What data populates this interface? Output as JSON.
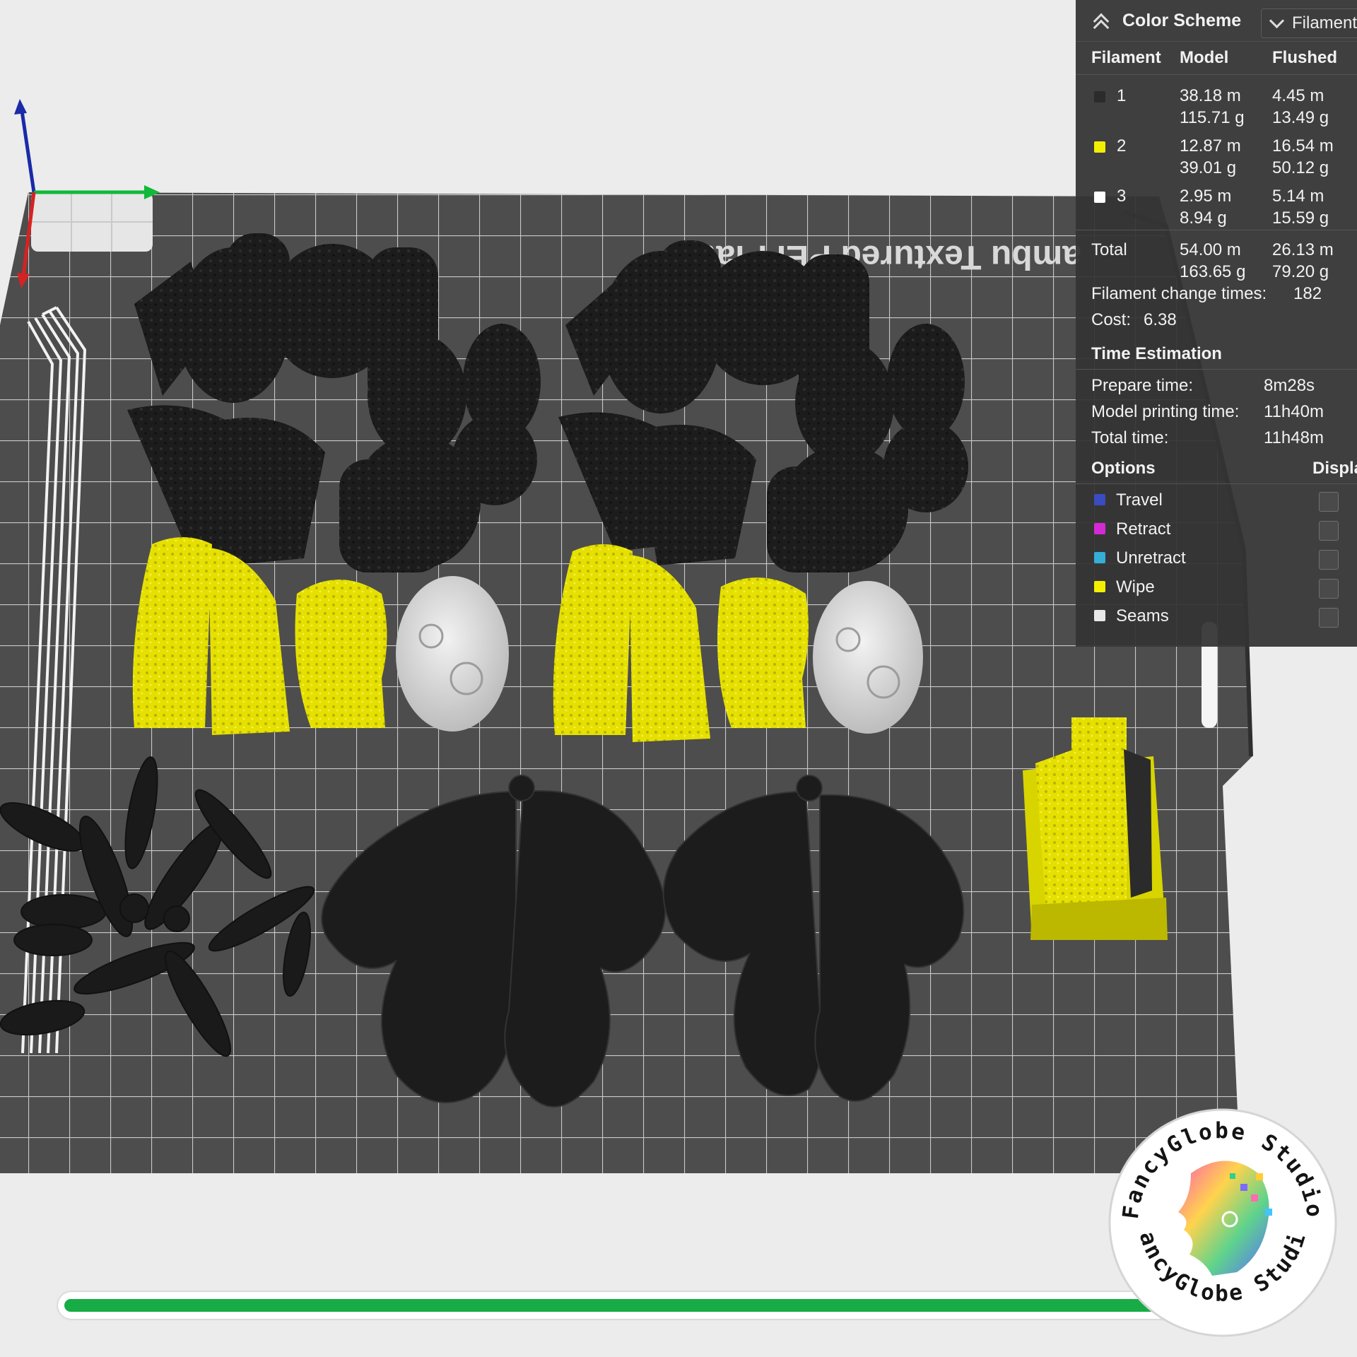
{
  "bed": {
    "label": "ambu Textured PEI Plate"
  },
  "panel": {
    "title": "Color Scheme",
    "scheme_select": "Filament",
    "columns": {
      "filament": "Filament",
      "model": "Model",
      "flushed": "Flushed"
    },
    "filaments": [
      {
        "id": "1",
        "color": "#2b2b2b",
        "model_len": "38.18 m",
        "model_wt": "115.71 g",
        "flush_len": "4.45 m",
        "flush_wt": "13.49 g"
      },
      {
        "id": "2",
        "color": "#f2ef00",
        "model_len": "12.87 m",
        "model_wt": "39.01 g",
        "flush_len": "16.54 m",
        "flush_wt": "50.12 g"
      },
      {
        "id": "3",
        "color": "#ffffff",
        "model_len": "2.95 m",
        "model_wt": "8.94 g",
        "flush_len": "5.14 m",
        "flush_wt": "15.59 g"
      }
    ],
    "total": {
      "label": "Total",
      "model_len": "54.00 m",
      "model_wt": "163.65 g",
      "flush_len": "26.13 m",
      "flush_wt": "79.20 g"
    },
    "change_times": {
      "label": "Filament change times:",
      "value": "182"
    },
    "cost": {
      "label": "Cost:",
      "value": "6.38"
    },
    "time_section": "Time Estimation",
    "prepare": {
      "label": "Prepare time:",
      "value": "8m28s"
    },
    "model_print": {
      "label": "Model printing time:",
      "value": "11h40m"
    },
    "total_time": {
      "label": "Total time:",
      "value": "11h48m"
    },
    "options_title": "Options",
    "display_title": "Display",
    "options": [
      {
        "label": "Travel",
        "color": "#3a4cc2"
      },
      {
        "label": "Retract",
        "color": "#d42ad4"
      },
      {
        "label": "Unretract",
        "color": "#35aed8"
      },
      {
        "label": "Wipe",
        "color": "#f3ef00"
      },
      {
        "label": "Seams",
        "color": "#e8e8e8"
      }
    ]
  },
  "progress": {
    "fraction": 0.995
  },
  "logo": {
    "text": "FancyGlobe Studio"
  },
  "icons": [
    "collapse-icon",
    "chevron-down-icon",
    "axis-gizmo-icon"
  ]
}
